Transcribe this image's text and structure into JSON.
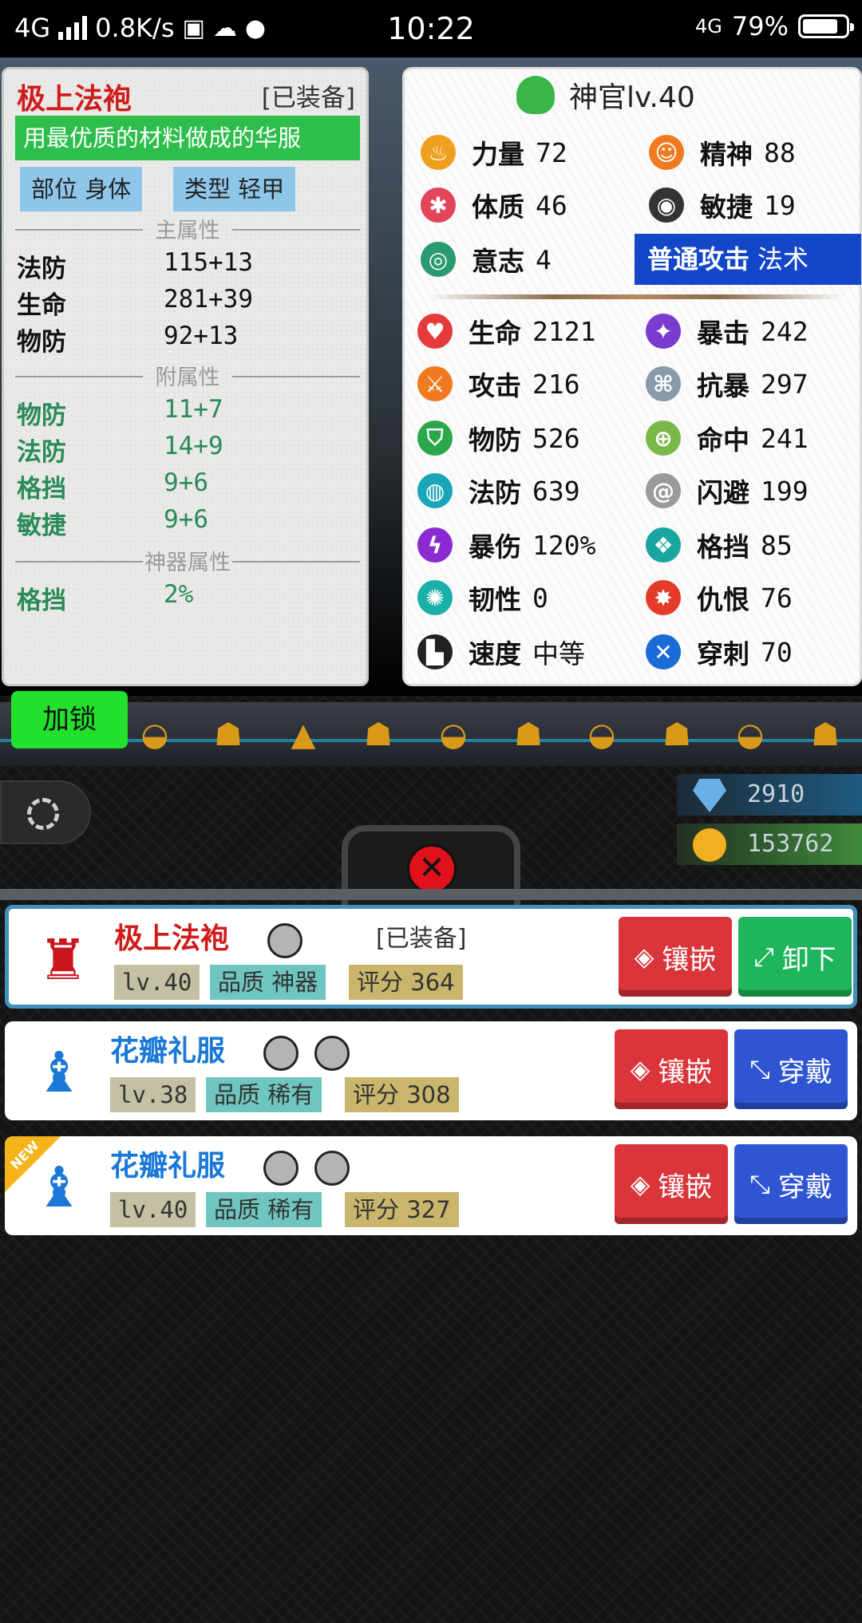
{
  "status_bar": {
    "network": "4G",
    "speed": "0.8K/s",
    "time": "10:22",
    "network_right": "4G",
    "battery": "79%"
  },
  "item_tooltip": {
    "name": "极上法袍",
    "equipped_tag": "[已装备]",
    "description": "用最优质的材料做成的华服",
    "slot_tag": "部位  身体",
    "type_tag": "类型  轻甲",
    "main_title": "主属性",
    "main_attrs": [
      {
        "k": "法防",
        "v": "115+13"
      },
      {
        "k": "生命",
        "v": "281+39"
      },
      {
        "k": "物防",
        "v": "92+13"
      }
    ],
    "sub_title": "附属性",
    "sub_attrs": [
      {
        "k": "物防",
        "v": "11+7"
      },
      {
        "k": "法防",
        "v": "14+9"
      },
      {
        "k": "格挡",
        "v": "9+6"
      },
      {
        "k": "敏捷",
        "v": "9+6"
      }
    ],
    "artifact_title": "神器属性",
    "artifact_attrs": [
      {
        "k": "格挡",
        "v": "2%"
      }
    ]
  },
  "character": {
    "title": "神官lv.40",
    "base": [
      {
        "k": "力量",
        "v": "72"
      },
      {
        "k": "精神",
        "v": "88"
      },
      {
        "k": "体质",
        "v": "46"
      },
      {
        "k": "敏捷",
        "v": "19"
      },
      {
        "k": "意志",
        "v": "4"
      }
    ],
    "attack_label": "普通攻击",
    "attack_type": "法术",
    "stats": [
      {
        "k": "生命",
        "v": "2121"
      },
      {
        "k": "暴击",
        "v": "242"
      },
      {
        "k": "攻击",
        "v": "216"
      },
      {
        "k": "抗暴",
        "v": "297"
      },
      {
        "k": "物防",
        "v": "526"
      },
      {
        "k": "命中",
        "v": "241"
      },
      {
        "k": "法防",
        "v": "639"
      },
      {
        "k": "闪避",
        "v": "199"
      },
      {
        "k": "暴伤",
        "v": "120%"
      },
      {
        "k": "格挡",
        "v": "85"
      },
      {
        "k": "韧性",
        "v": "0"
      },
      {
        "k": "仇恨",
        "v": "76"
      },
      {
        "k": "速度",
        "v": "中等"
      },
      {
        "k": "穿刺",
        "v": "70"
      }
    ]
  },
  "lock_button": "加锁",
  "currencies": {
    "diamonds": "2910",
    "gold": "153762"
  },
  "gear_list": [
    {
      "name": "极上法袍",
      "equipped": "[已装备]",
      "level": "lv.40",
      "quality": "品质  神器",
      "score": "评分  364",
      "inlay": "镶嵌",
      "action": "卸下"
    },
    {
      "name": "花瓣礼服",
      "level": "lv.38",
      "quality": "品质  稀有",
      "score": "评分  308",
      "inlay": "镶嵌",
      "action": "穿戴"
    },
    {
      "name": "花瓣礼服",
      "level": "lv.40",
      "quality": "品质  稀有",
      "score": "评分  327",
      "inlay": "镶嵌",
      "action": "穿戴",
      "badge": "NEW"
    }
  ],
  "colors": {
    "item_name_red": "#d01c1c",
    "desc_green": "#2dbe4b",
    "sub_attr_green": "#2a8a5a",
    "attack_blue": "#1446c8",
    "inlay_red": "#d9353b",
    "unequip_green": "#1fb55a",
    "equip_blue": "#2f55d2",
    "lock_green": "#22e02c"
  }
}
